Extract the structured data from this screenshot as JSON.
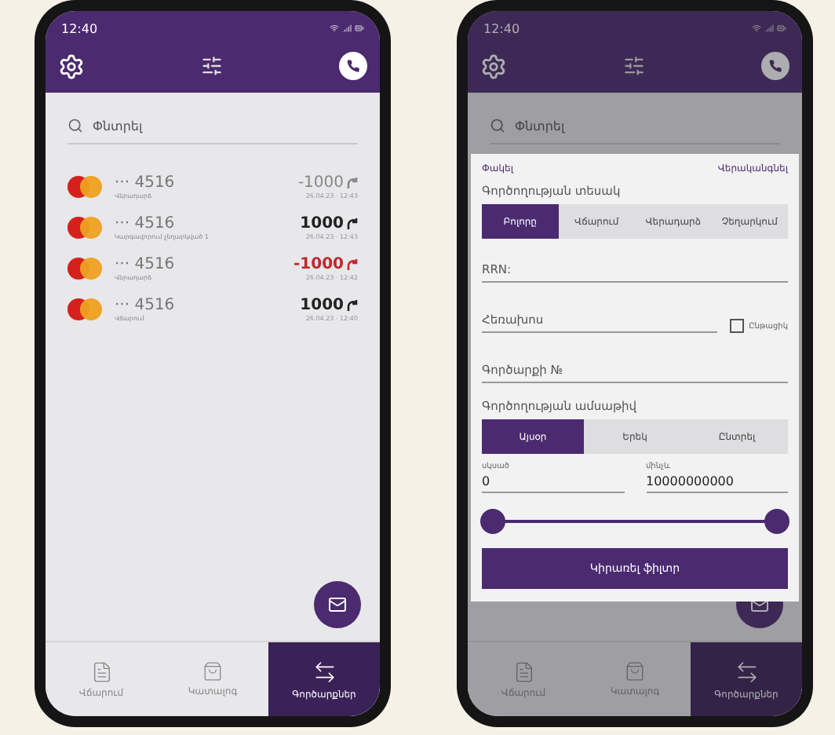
{
  "left_screen": {
    "status_time": "12:40",
    "search": {
      "placeholder": "Փնտրել"
    },
    "transactions": [
      {
        "card": "··· 4516",
        "description": "Վերադարձ",
        "amount": "-1000",
        "datetime": "26.04.23 · 12:43",
        "kind": "muted"
      },
      {
        "card": "··· 4516",
        "description": "Կարգավորում չեղարկված 1",
        "amount": "1000",
        "datetime": "26.04.23 · 12:43",
        "kind": "normal"
      },
      {
        "card": "··· 4516",
        "description": "Վերադարձ",
        "amount": "-1000",
        "datetime": "26.04.23 · 12:42",
        "kind": "negative"
      },
      {
        "card": "··· 4516",
        "description": "Վճարում",
        "amount": "1000",
        "datetime": "26.04.23 · 12:40",
        "kind": "normal"
      }
    ],
    "nav": [
      {
        "label": "Վճարում",
        "kind": "receipt",
        "selected": false
      },
      {
        "label": "Կատալոգ",
        "kind": "bag",
        "selected": false
      },
      {
        "label": "Գործարքներ",
        "kind": "arrows",
        "selected": true
      }
    ]
  },
  "right_screen": {
    "status_time": "12:40",
    "search": {
      "placeholder": "Փնտրել"
    },
    "nav": [
      {
        "label": "Վճարում",
        "kind": "receipt",
        "selected": false
      },
      {
        "label": "Կատալոգ",
        "kind": "bag",
        "selected": false
      },
      {
        "label": "Գործարքներ",
        "kind": "arrows",
        "selected": true
      }
    ],
    "filter": {
      "close": "Փակել",
      "reset": "Վերականգնել",
      "operation_type_label": "Գործողության տեսակ",
      "operation_types": [
        {
          "label": "Բոլորը",
          "selected": true
        },
        {
          "label": "Վճարում",
          "selected": false
        },
        {
          "label": "Վերադարձ",
          "selected": false
        },
        {
          "label": "Չեղարկում",
          "selected": false
        }
      ],
      "rrn": {
        "placeholder": "RRN:"
      },
      "phone": {
        "placeholder": "Հեռախոս"
      },
      "current": {
        "label": "Ընթացիկ",
        "checked": false
      },
      "transaction_no": {
        "placeholder": "Գործարքի №"
      },
      "date_label": "Գործողության ամսաթիվ",
      "date_options": [
        {
          "label": "Այսօր",
          "selected": true
        },
        {
          "label": "Երեկ",
          "selected": false
        },
        {
          "label": "Ընտրել",
          "selected": false
        }
      ],
      "amount_from": {
        "label": "սկսած",
        "value": "0"
      },
      "amount_to": {
        "label": "մինչև",
        "value": "10000000000"
      },
      "slider": {
        "handles": [
          {
            "level": 0
          },
          {
            "level": 1
          }
        ]
      },
      "apply": "Կիրառել ֆիլտր"
    }
  }
}
